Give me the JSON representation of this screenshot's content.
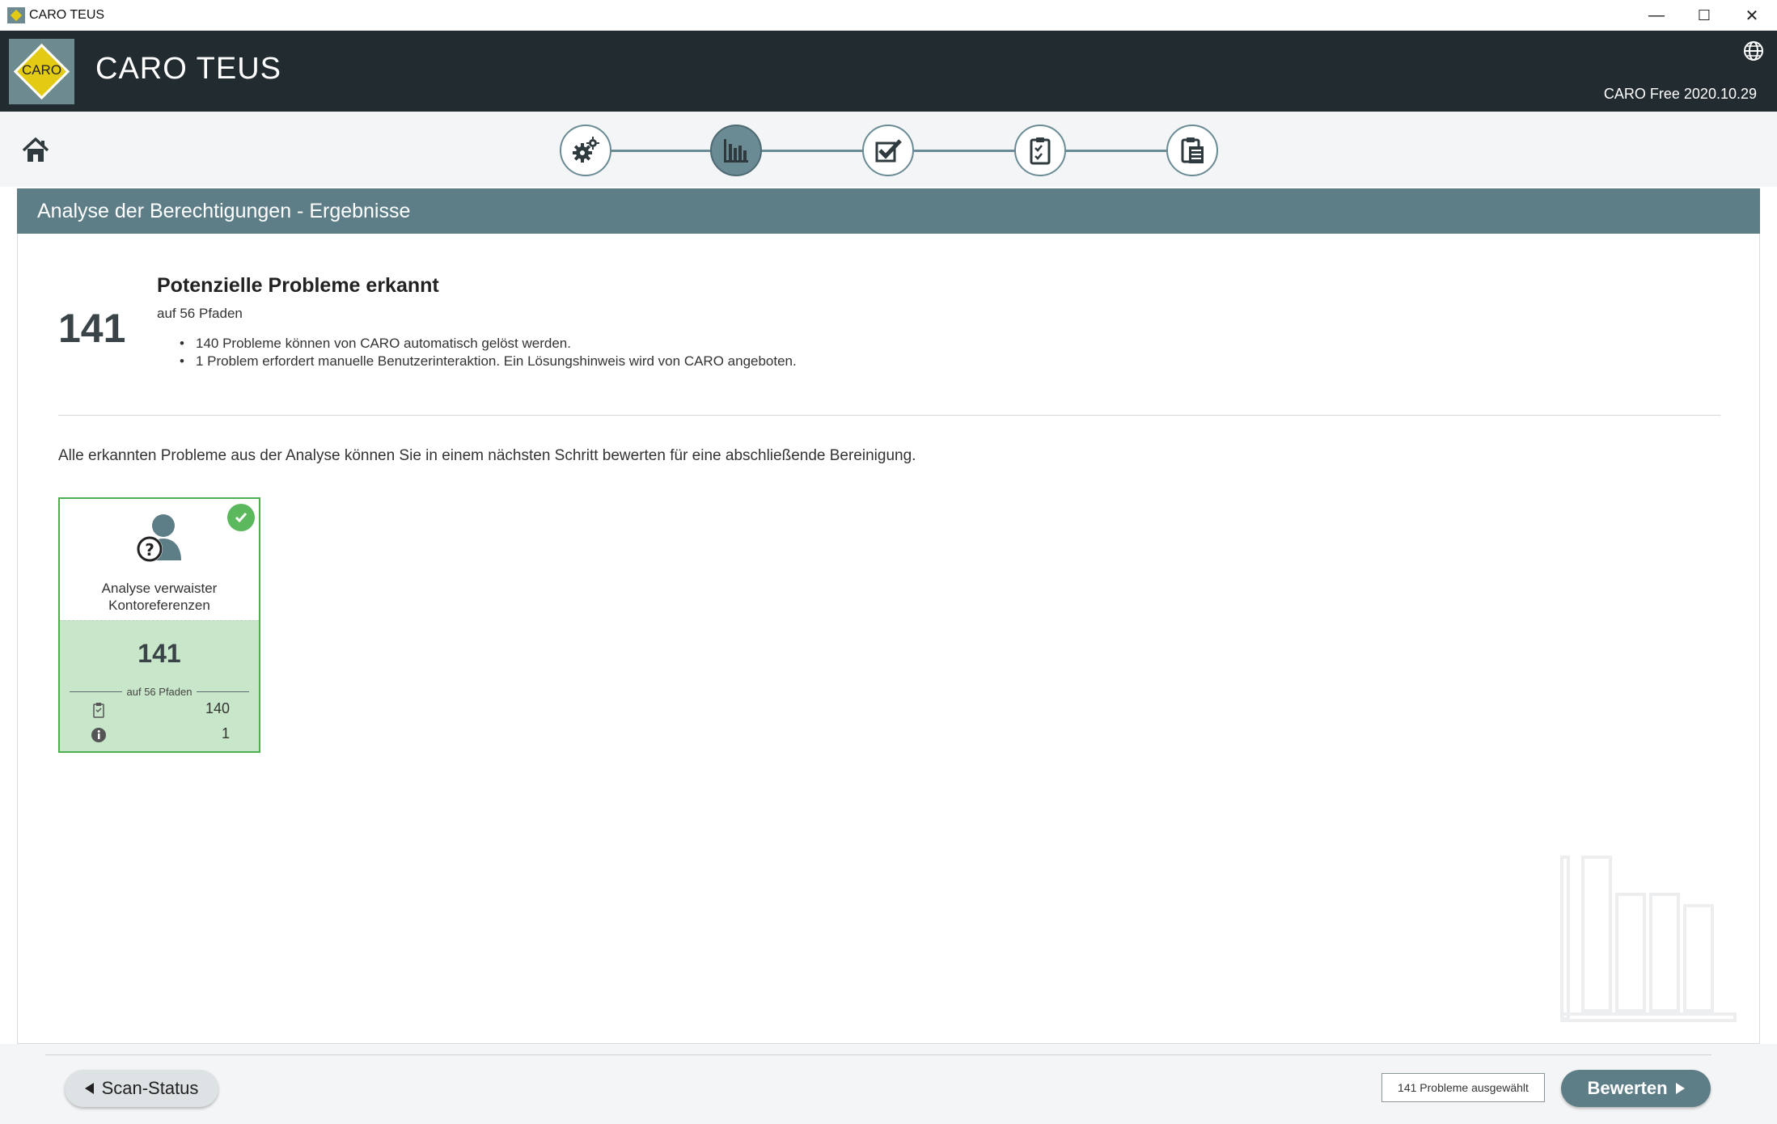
{
  "window": {
    "title": "CARO TEUS",
    "minimize": "—",
    "maximize": "☐",
    "close": "✕"
  },
  "header": {
    "logo_text": "CARO",
    "app_title": "CARO TEUS",
    "version": "CARO Free 2020.10.29"
  },
  "colors": {
    "header_bg": "#222b30",
    "accent": "#5e7e87",
    "logo_yellow": "#e3cb14",
    "success": "#5cb85c",
    "card_bg": "#c8e6c9"
  },
  "steps": [
    {
      "icon": "gears-icon",
      "active": false
    },
    {
      "icon": "bar-chart-icon",
      "active": true
    },
    {
      "icon": "checkbox-check-icon",
      "active": false
    },
    {
      "icon": "clipboard-check-icon",
      "active": false
    },
    {
      "icon": "report-icon",
      "active": false
    }
  ],
  "section": {
    "title": "Analyse der Berechtigungen - Ergebnisse"
  },
  "summary": {
    "count": "141",
    "title": "Potenzielle Probleme erkannt",
    "subtitle": "auf 56 Pfaden",
    "points": [
      "140 Probleme können von CARO automatisch gelöst werden.",
      "1 Problem erfordert manuelle Benutzerinteraktion. Ein Lösungshinweis wird von CARO angeboten."
    ],
    "intro": "Alle erkannten Probleme aus der Analyse können Sie in einem nächsten Schritt bewerten für eine abschließende Bereinigung."
  },
  "card": {
    "label_line1": "Analyse verwaister",
    "label_line2": "Kontoreferenzen",
    "count": "141",
    "paths": "auf 56 Pfaden",
    "auto_solvable": "140",
    "manual": "1"
  },
  "footer": {
    "back_label": "Scan-Status",
    "selected": "141 Probleme ausgewählt",
    "next_label": "Bewerten"
  }
}
